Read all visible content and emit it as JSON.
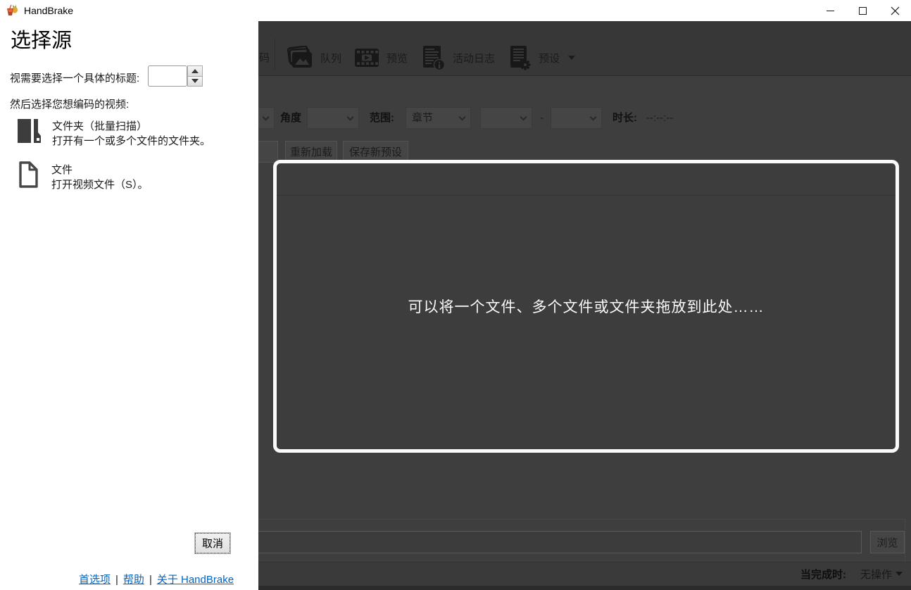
{
  "title_bar": {
    "app_name": "HandBrake"
  },
  "panel": {
    "heading": "选择源",
    "title_label": "视需要选择一个具体的标题:",
    "title_value": "",
    "choose_label": "然后选择您想编码的视频:",
    "options": [
      {
        "title": "文件夹（批量扫描）",
        "desc": "打开有一个或多个文件的文件夹。",
        "icon": "folder-batch-icon"
      },
      {
        "title": "文件",
        "desc": "打开视频文件（S）。",
        "icon": "file-icon"
      }
    ],
    "cancel_label": "取消",
    "footer_links": {
      "preferences": "首选项",
      "help": "帮助",
      "about": "关于 HandBrake"
    },
    "link_separator": "|"
  },
  "toolbar": {
    "encode_partial": "码",
    "buttons": [
      {
        "label": "队列",
        "icon": "queue-icon"
      },
      {
        "label": "预览",
        "icon": "preview-icon"
      },
      {
        "label": "活动日志",
        "icon": "activity-log-icon"
      },
      {
        "label": "预设",
        "icon": "presets-icon",
        "has_dropdown": true
      }
    ]
  },
  "source_row": {
    "angle_label": "角度",
    "angle_value": "",
    "range_label": "范围:",
    "range_value": "章节",
    "range_from": "",
    "range_separator": "-",
    "range_to": "",
    "duration_label": "时长:",
    "duration_value": "--:--:--"
  },
  "preset_row": {
    "reload_label": "重新加载",
    "save_label": "保存新预设"
  },
  "drop_zone": {
    "message": "可以将一个文件、多个文件或文件夹拖放到此处……"
  },
  "destination": {
    "path_value": "",
    "browse_label": "浏览"
  },
  "status_bar": {
    "when_done_label": "当完成时:",
    "when_done_value": "无操作"
  },
  "colors": {
    "overlay_bg": "#3e3e3e",
    "toolbar_bg": "#373737",
    "dropzone_border": "#fafafa",
    "link_blue": "#0563c1",
    "panel_bg": "#ffffff"
  }
}
